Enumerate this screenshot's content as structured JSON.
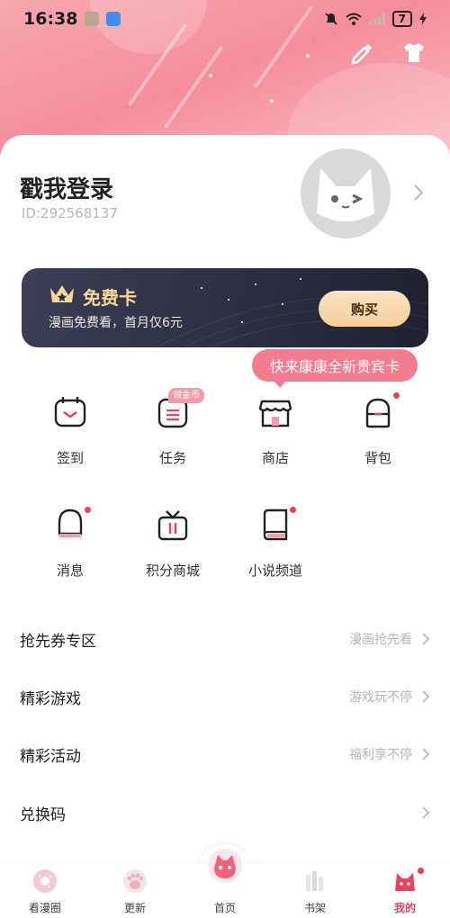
{
  "status_bar": {
    "time": "16:38",
    "battery": "7"
  },
  "profile": {
    "name": "戳我登录",
    "id": "ID:292568137"
  },
  "vip_card": {
    "title": "免费卡",
    "subtitle": "漫画免费看，首月仅6元",
    "buy_label": "购买"
  },
  "tooltip": "快来康康全新贵宾卡",
  "grid": {
    "items": [
      {
        "label": "签到",
        "icon": "calendar-check-icon",
        "badge": "",
        "dot": false
      },
      {
        "label": "任务",
        "icon": "task-list-icon",
        "badge": "领金币",
        "dot": false
      },
      {
        "label": "商店",
        "icon": "store-icon",
        "badge": "",
        "dot": false
      },
      {
        "label": "背包",
        "icon": "backpack-icon",
        "badge": "",
        "dot": true
      },
      {
        "label": "消息",
        "icon": "bell-icon",
        "badge": "",
        "dot": true
      },
      {
        "label": "积分商城",
        "icon": "gift-icon",
        "badge": "",
        "dot": false
      },
      {
        "label": "小说频道",
        "icon": "book-icon",
        "badge": "",
        "dot": true
      }
    ]
  },
  "menu": [
    {
      "title": "抢先券专区",
      "hint": "漫画抢先看"
    },
    {
      "title": "精彩游戏",
      "hint": "游戏玩不停"
    },
    {
      "title": "精彩活动",
      "hint": "福利享不停"
    },
    {
      "title": "兑换码",
      "hint": ""
    }
  ],
  "tabbar": {
    "tabs": [
      {
        "label": "看漫圈",
        "icon": "donut-icon",
        "active": false
      },
      {
        "label": "更新",
        "icon": "paw-icon",
        "active": false
      },
      {
        "label": "首页",
        "icon": "home-cat-icon",
        "active": false
      },
      {
        "label": "书架",
        "icon": "bookshelf-icon",
        "active": false
      },
      {
        "label": "我的",
        "icon": "cat-profile-icon",
        "active": true
      }
    ]
  },
  "colors": {
    "accent": "#f0405a",
    "hero_pink": "#f58e9c",
    "vip_dark": "#2b2d40",
    "vip_gold": "#f5d79a",
    "tooltip_pink": "#f47c8f"
  }
}
